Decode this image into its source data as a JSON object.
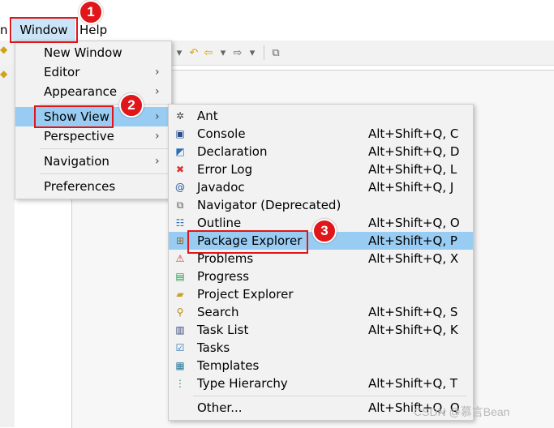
{
  "menubar": {
    "partial_label": "n",
    "window_label": "Window",
    "help_label": "Help"
  },
  "window_menu": {
    "items": [
      {
        "label": "New Window",
        "has_submenu": false
      },
      {
        "label": "Editor",
        "has_submenu": true
      },
      {
        "label": "Appearance",
        "has_submenu": true
      },
      {
        "label": "Show View",
        "has_submenu": true,
        "highlighted": true
      },
      {
        "label": "Perspective",
        "has_submenu": true
      },
      {
        "label": "Navigation",
        "has_submenu": true
      },
      {
        "label": "Preferences",
        "has_submenu": false
      }
    ],
    "submenu_arrow": "›"
  },
  "show_view_menu": {
    "items": [
      {
        "label": "Ant",
        "shortcut": "",
        "icon": "ant-icon"
      },
      {
        "label": "Console",
        "shortcut": "Alt+Shift+Q, C",
        "icon": "console-icon"
      },
      {
        "label": "Declaration",
        "shortcut": "Alt+Shift+Q, D",
        "icon": "declaration-icon"
      },
      {
        "label": "Error Log",
        "shortcut": "Alt+Shift+Q, L",
        "icon": "error-log-icon"
      },
      {
        "label": "Javadoc",
        "shortcut": "Alt+Shift+Q, J",
        "icon": "javadoc-icon"
      },
      {
        "label": "Navigator (Deprecated)",
        "shortcut": "",
        "icon": "navigator-icon"
      },
      {
        "label": "Outline",
        "shortcut": "Alt+Shift+Q, O",
        "icon": "outline-icon"
      },
      {
        "label": "Package Explorer",
        "shortcut": "Alt+Shift+Q, P",
        "icon": "package-explorer-icon",
        "highlighted": true
      },
      {
        "label": "Problems",
        "shortcut": "Alt+Shift+Q, X",
        "icon": "problems-icon"
      },
      {
        "label": "Progress",
        "shortcut": "",
        "icon": "progress-icon"
      },
      {
        "label": "Project Explorer",
        "shortcut": "",
        "icon": "project-explorer-icon"
      },
      {
        "label": "Search",
        "shortcut": "Alt+Shift+Q, S",
        "icon": "search-icon"
      },
      {
        "label": "Task List",
        "shortcut": "Alt+Shift+Q, K",
        "icon": "task-list-icon"
      },
      {
        "label": "Tasks",
        "shortcut": "",
        "icon": "tasks-icon"
      },
      {
        "label": "Templates",
        "shortcut": "",
        "icon": "templates-icon"
      },
      {
        "label": "Type Hierarchy",
        "shortcut": "Alt+Shift+Q, T",
        "icon": "type-hierarchy-icon"
      },
      {
        "label": "Other...",
        "shortcut": "Alt+Shift+Q, Q",
        "icon": ""
      }
    ]
  },
  "annotations": {
    "step1": "1",
    "step2": "2",
    "step3": "3",
    "color": "#e0161a"
  },
  "watermark": "CSDN @慕言Bean",
  "colors": {
    "highlight": "#99ccf3",
    "menubar_hover": "#cce4f7",
    "menu_bg": "#f2f2f2"
  }
}
